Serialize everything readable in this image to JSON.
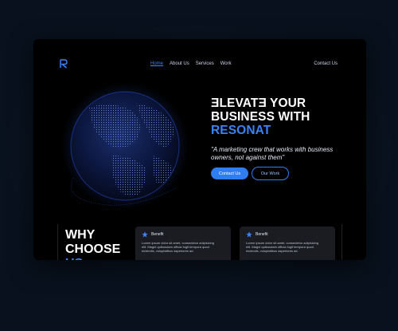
{
  "nav": {
    "items": [
      {
        "label": "Home",
        "active": true
      },
      {
        "label": "About Us",
        "active": false
      },
      {
        "label": "Services",
        "active": false
      },
      {
        "label": "Work",
        "active": false
      }
    ],
    "contact": "Contact Us"
  },
  "hero": {
    "line1": "ƎLEVATƎ YOUR",
    "line2": "BUSINESS WITH",
    "brand": "RESONAT",
    "tagline": "\"A marketing crew that works with business owners, not against them\"",
    "primary_button": "Contact Us",
    "secondary_button": "Our Work"
  },
  "why": {
    "line1": "WHY",
    "line2": "CHOOSE",
    "line3": "US"
  },
  "cards": [
    {
      "title": "Benefit",
      "body": [
        "Lorem ipsum dolor sit amet, consectetur adipisicing",
        "elit. Magni quibusdam officia fugit tempora quod",
        "eiciendis, voluptatibus asperiores ad."
      ]
    },
    {
      "title": "Benefit",
      "body": [
        "Lorem ipsum dolor sit amet, consectetur adipisicing",
        "elit. Magni quibusdam officia fugit tempora quod",
        "eiciendis, voluptatibus asperiores ad."
      ]
    }
  ],
  "colors": {
    "accent": "#3b82f6",
    "background": "#000000",
    "card": "#1a1c22"
  },
  "icons": {
    "logo": "r-logo-icon",
    "globe": "dotted-globe-illustration",
    "card": "star-icon"
  }
}
